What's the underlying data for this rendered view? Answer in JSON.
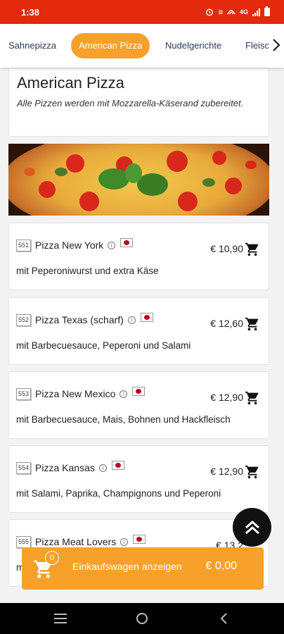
{
  "status_bar": {
    "time": "1:38",
    "network": "4G",
    "icons": [
      "alarm-icon",
      "volte-icon",
      "hotspot-icon",
      "signal-icon",
      "battery-icon"
    ]
  },
  "tabs": [
    {
      "label": "Sahnepizza",
      "active": false
    },
    {
      "label": "American Pizza",
      "active": true
    },
    {
      "label": "Nudelgerichte",
      "active": false
    },
    {
      "label": "Fleisc",
      "active": false
    }
  ],
  "category": {
    "title": "American Pizza",
    "description": "Alle Pizzen werden mit Mozzarella-Käserand zubereitet."
  },
  "items": [
    {
      "number": "551",
      "name": "Pizza New York",
      "price": "€ 10,90",
      "description": "mit Peperoniwurst und extra Käse"
    },
    {
      "number": "552",
      "name": "Pizza Texas (scharf)",
      "price": "€ 12,60",
      "description": "mit Barbecuesauce, Peperoni und Salami"
    },
    {
      "number": "553",
      "name": "Pizza New Mexico",
      "price": "€ 12,90",
      "description": "mit Barbecuesauce, Mais, Bohnen und Hackfleisch"
    },
    {
      "number": "554",
      "name": "Pizza Kansas",
      "price": "€ 12,90",
      "description": "mit Salami, Paprika, Champignons und Peperoni"
    },
    {
      "number": "555",
      "name": "Pizza Meat Lovers",
      "price": "€ 13,2",
      "description": "m"
    }
  ],
  "cart": {
    "count": "0",
    "label": "Einkaufswagen anzeigen",
    "total": "€ 0,00"
  },
  "colors": {
    "status_bar": "#e12b0c",
    "accent": "#f7a02a",
    "text": "#222222"
  }
}
